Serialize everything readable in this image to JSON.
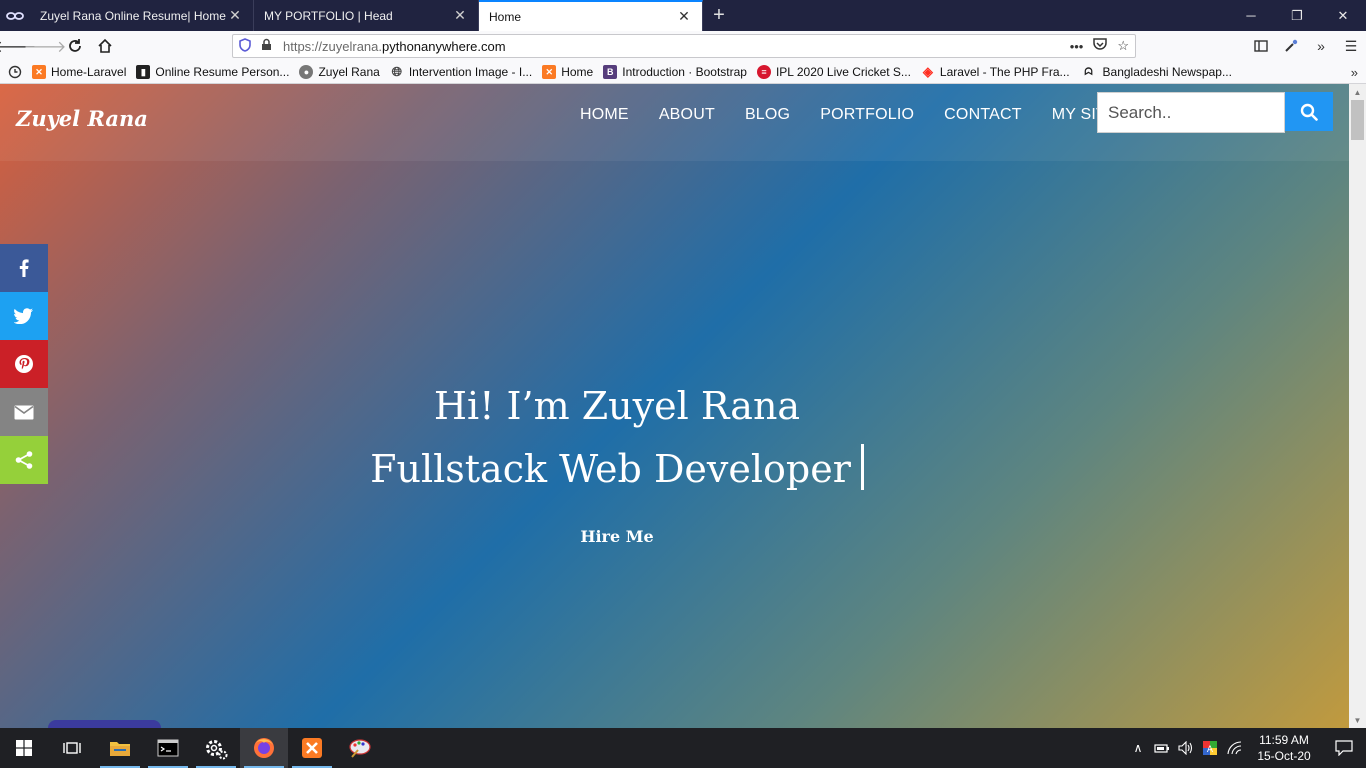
{
  "browser": {
    "tabs": [
      {
        "title": "Zuyel Rana Online Resume| Home"
      },
      {
        "title": "MY PORTFOLIO | Head"
      },
      {
        "title": "Home"
      }
    ],
    "url_prefix": "https://zuyelrana.",
    "url_host": "pythonanywhere.com",
    "bookmarks": [
      {
        "label": "Home-Laravel",
        "icon": "xampp-icon",
        "color": "#fb7a24"
      },
      {
        "label": "Online Resume Person...",
        "icon": "book-icon",
        "color": "#222222"
      },
      {
        "label": "Zuyel Rana",
        "icon": "avatar-icon",
        "color": "#555555"
      },
      {
        "label": "Intervention Image - I...",
        "icon": "globe-icon",
        "color": "#444444"
      },
      {
        "label": "Home",
        "icon": "xampp-icon",
        "color": "#fb7a24"
      },
      {
        "label": "Introduction · Bootstrap",
        "icon": "bootstrap-icon",
        "color": "#563d7c"
      },
      {
        "label": "IPL 2020 Live Cricket S...",
        "icon": "cricket-icon",
        "color": "#d7172f"
      },
      {
        "label": "Laravel - The PHP Fra...",
        "icon": "laravel-icon",
        "color": "#ff2d20"
      },
      {
        "label": "Bangladeshi Newspap...",
        "icon": "newspaper-icon",
        "color": "#222222"
      }
    ]
  },
  "site": {
    "logo": "Zuyel Rana",
    "menu": [
      "HOME",
      "ABOUT",
      "BLOG",
      "PORTFOLIO",
      "CONTACT",
      "MY SITE"
    ],
    "search_placeholder": "Search..",
    "hero_line1": "Hi! I’m Zuyel Rana",
    "hero_line2": "Fullstack Web Developer",
    "hire_label": "Hire Me",
    "share": [
      {
        "name": "facebook",
        "color": "#3b5998"
      },
      {
        "name": "twitter",
        "color": "#1da1f2"
      },
      {
        "name": "pinterest",
        "color": "#cb2027"
      },
      {
        "name": "email",
        "color": "#848484"
      },
      {
        "name": "share",
        "color": "#95d03a"
      }
    ]
  },
  "taskbar": {
    "time": "11:59 AM",
    "date": "15-Oct-20"
  }
}
